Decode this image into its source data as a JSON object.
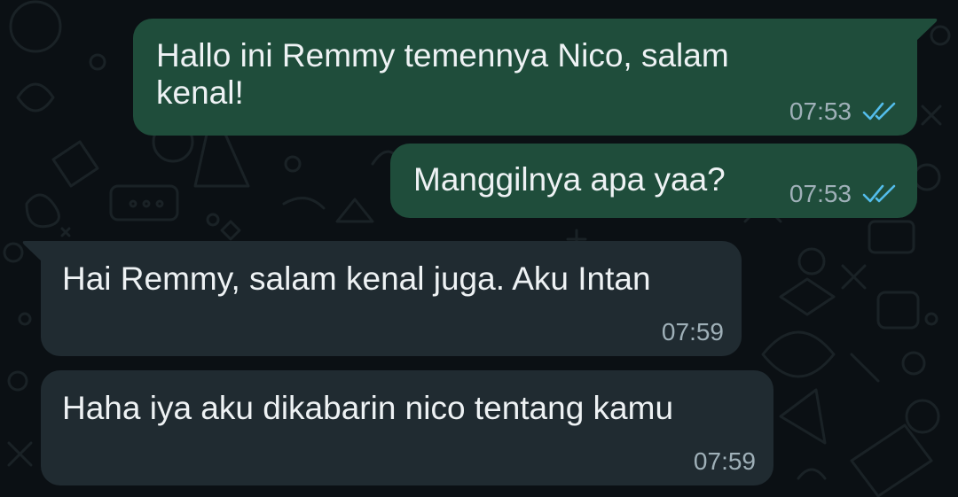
{
  "chat": {
    "colors": {
      "background": "#0b1014",
      "outgoing_bubble": "#1f4d3b",
      "incoming_bubble": "#202b31",
      "text": "#eef2f4",
      "timestamp": "#9fb0b8",
      "read_ticks": "#53bdeb"
    },
    "messages": [
      {
        "direction": "outgoing",
        "text_line1": "Hallo ini Remmy temennya Nico, salam",
        "text_line2": "kenal!",
        "time": "07:53",
        "status_icon": "double-check-read-icon"
      },
      {
        "direction": "outgoing",
        "text": "Manggilnya apa yaa?",
        "time": "07:53",
        "status_icon": "double-check-read-icon"
      },
      {
        "direction": "incoming",
        "text": "Hai Remmy, salam kenal juga. Aku Intan",
        "time": "07:59"
      },
      {
        "direction": "incoming",
        "text": "Haha iya aku dikabarin nico tentang kamu",
        "time": "07:59"
      }
    ]
  }
}
